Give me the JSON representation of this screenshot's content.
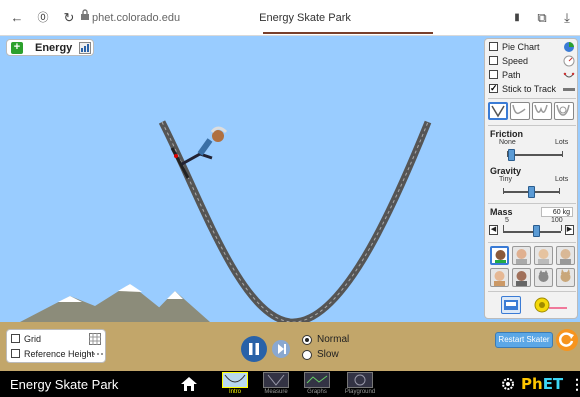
{
  "browser": {
    "url": "phet.colorado.edu",
    "title": "Energy Skate Park",
    "back_icon": "←",
    "shield_icon": "⓪",
    "refresh_icon": "↻",
    "lock_icon": "🔒",
    "bookmark_icon": "▮",
    "tabs_icon": "⧉",
    "download_icon": "⤓"
  },
  "energy_panel": {
    "label": "Energy",
    "expand_icon": "+"
  },
  "options": {
    "pie_chart": {
      "label": "Pie Chart",
      "checked": false
    },
    "speed": {
      "label": "Speed",
      "checked": false
    },
    "path": {
      "label": "Path",
      "checked": false
    },
    "stick_to_track": {
      "label": "Stick to Track",
      "checked": true
    }
  },
  "friction": {
    "title": "Friction",
    "min_label": "None",
    "max_label": "Lots",
    "value_fraction": 0.0
  },
  "gravity": {
    "title": "Gravity",
    "min_label": "Tiny",
    "max_label": "Lots",
    "value_fraction": 0.5
  },
  "mass": {
    "title": "Mass",
    "value": "60 kg",
    "min_label": "5",
    "max_label": "100",
    "value_fraction": 0.57,
    "dec_icon": "◀",
    "inc_icon": "▶"
  },
  "bottom_left": {
    "grid_label": "Grid",
    "reference_height_label": "Reference Height"
  },
  "speed_controls": {
    "normal_label": "Normal",
    "slow_label": "Slow",
    "selected": "Normal"
  },
  "restart_label": "Restart Skater",
  "navbar": {
    "title": "Energy Skate Park",
    "screens": [
      {
        "label": "Intro",
        "selected": true
      },
      {
        "label": "Measure",
        "selected": false
      },
      {
        "label": "Graphs",
        "selected": false
      },
      {
        "label": "Playground",
        "selected": false
      }
    ],
    "logo_ph": "Ph",
    "logo_et": "ET",
    "kebab_icon": "⋮"
  },
  "colors": {
    "sky": "#99ccff",
    "ground": "#c2a66a",
    "play_button": "#2962a8",
    "reset_button": "#f7941d",
    "restart_button": "#5ba7e6",
    "phet_yellow": "#ffc700",
    "phet_cyan": "#3dd6f5"
  }
}
